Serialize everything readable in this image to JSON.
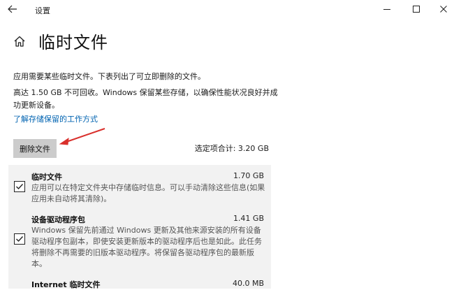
{
  "window": {
    "title": "设置"
  },
  "page": {
    "title": "临时文件",
    "description": "应用需要某些临时文件。下表列出了可立即删除的文件。",
    "info": "高达 1.50 GB 不可回收。Windows 保留某些存储，以确保性能状况良好并成功更新设备。",
    "learn_link": "了解存储保留的工作方式"
  },
  "actions": {
    "delete_label": "删除文件",
    "total_label": "选定项合计: 3.20 GB"
  },
  "items": [
    {
      "title": "临时文件",
      "size": "1.70 GB",
      "description": "应用可以在特定文件夹中存储临时信息。可以手动清除这些信息(如果应用未自动将其清除)。",
      "checked": true
    },
    {
      "title": "设备驱动程序包",
      "size": "1.41 GB",
      "description": "Windows 保留先前通过 Windows 更新及其他来源安装的所有设备驱动程序包副本，即使安装更新版本的驱动程序后也是如此。此任务将删除不再需要的旧版本驱动程序。将保留各驱动程序包的最新版本。",
      "checked": true
    },
    {
      "title": "Internet 临时文件",
      "size": "40.0 MB",
      "description": "",
      "checked": true
    }
  ],
  "colors": {
    "link": "#0063b1",
    "button_bg": "#cccccc",
    "panel_bg": "#f2f2f2",
    "annotation_arrow": "#d9302c"
  },
  "icons": {
    "back": "back-arrow-icon",
    "home": "home-icon",
    "minimize": "minimize-icon",
    "maximize": "maximize-icon",
    "close": "close-icon",
    "check": "checkmark-icon"
  }
}
